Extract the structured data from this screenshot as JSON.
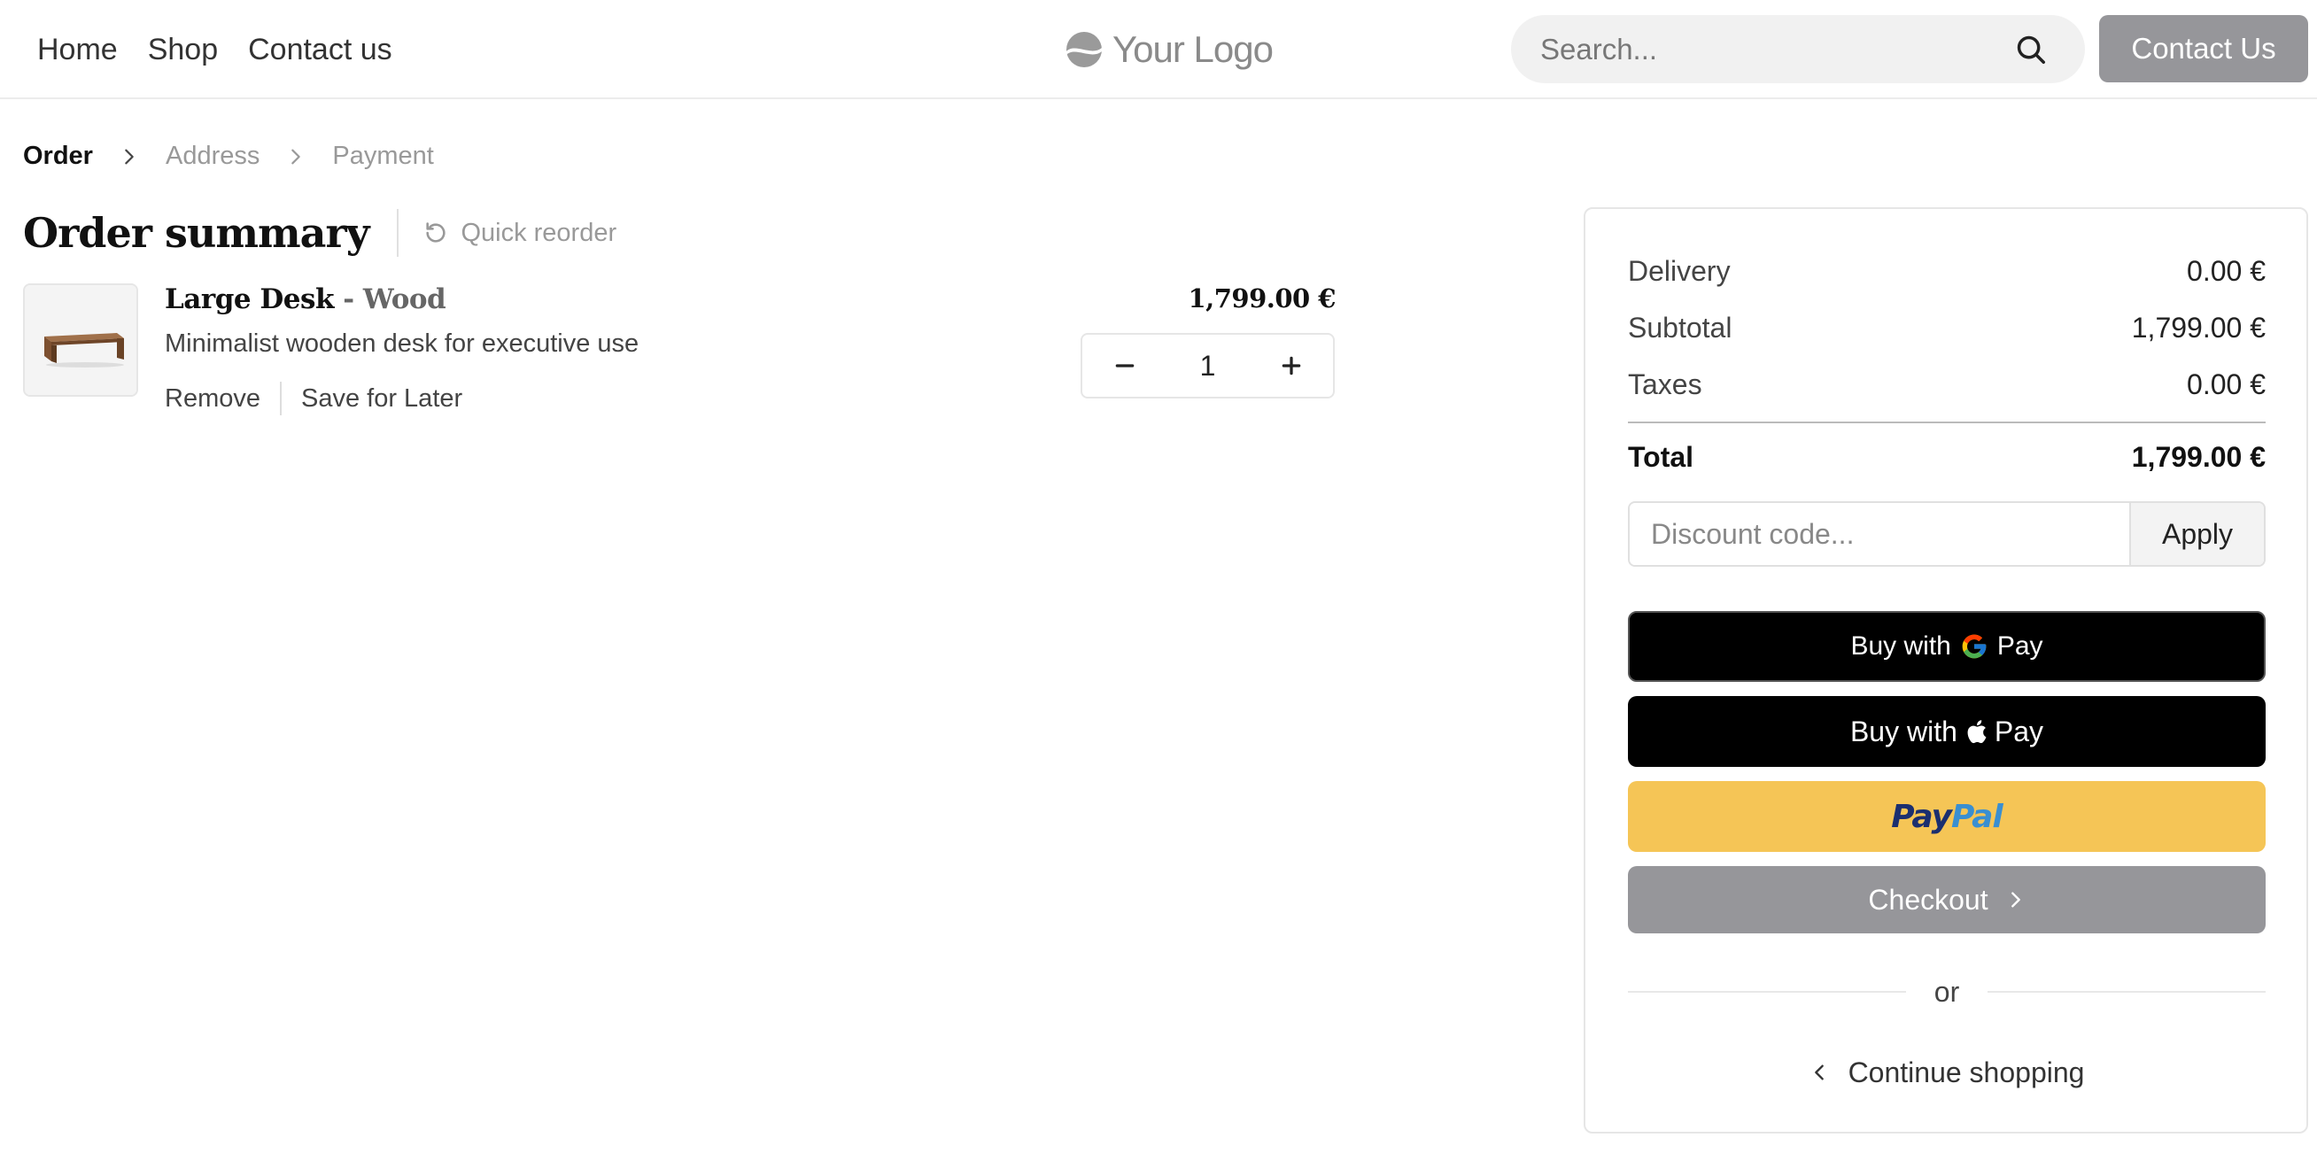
{
  "header": {
    "nav": [
      "Home",
      "Shop",
      "Contact us"
    ],
    "logo_text": "Your Logo",
    "search_placeholder": "Search...",
    "contact_button": "Contact Us"
  },
  "breadcrumb": {
    "steps": [
      "Order",
      "Address",
      "Payment"
    ],
    "active": "Order"
  },
  "order": {
    "title": "Order summary",
    "quick_reorder": "Quick reorder",
    "item": {
      "name": "Large Desk",
      "variant": "Wood",
      "description": "Minimalist wooden desk for executive use",
      "price": "1,799.00 €",
      "quantity": "1",
      "remove_label": "Remove",
      "save_label": "Save for Later"
    }
  },
  "summary": {
    "rows": [
      {
        "label": "Delivery",
        "value": "0.00 €"
      },
      {
        "label": "Subtotal",
        "value": "1,799.00 €"
      },
      {
        "label": "Taxes",
        "value": "0.00 €"
      }
    ],
    "total_label": "Total",
    "total_value": "1,799.00 €",
    "discount_placeholder": "Discount code...",
    "apply_label": "Apply",
    "gpay_prefix": "Buy with",
    "gpay_brand": "Pay",
    "apay_prefix": "Buy with",
    "apay_brand": "Pay",
    "paypal_a": "Pay",
    "paypal_b": "Pal",
    "checkout_label": "Checkout",
    "or_label": "or",
    "continue_label": "Continue shopping"
  },
  "colors": {
    "accent_gray": "#96969a",
    "paypal_yellow": "#f5c556",
    "paypal_dark": "#1b2f6f",
    "paypal_light": "#3a8fd1"
  }
}
